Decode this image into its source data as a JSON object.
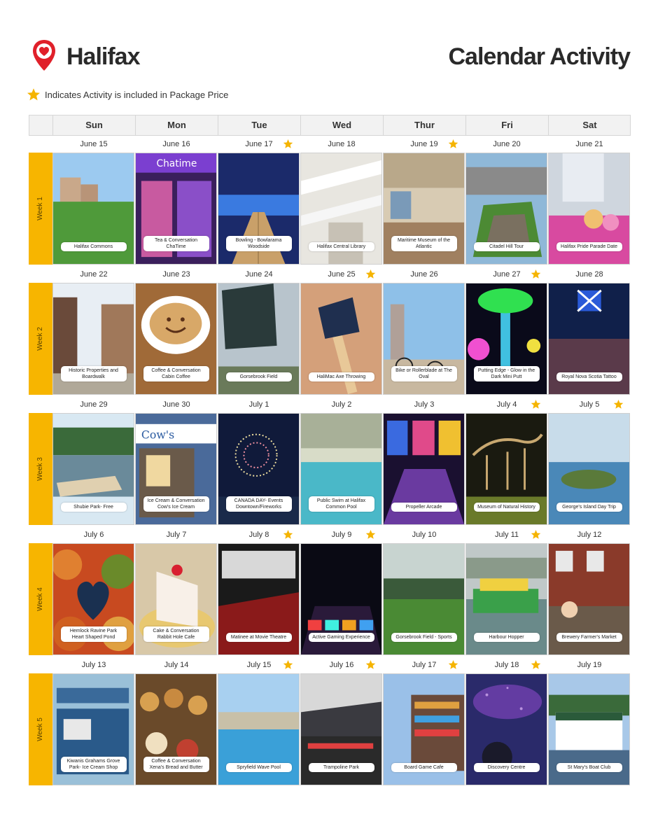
{
  "header": {
    "brand": "Halifax",
    "title": "Calendar Activity",
    "legend_text": "Indicates Activity is included in Package Price"
  },
  "colors": {
    "accent": "#f7b500",
    "pin": "#e0202a",
    "star": "#f5b400"
  },
  "days": [
    "Sun",
    "Mon",
    "Tue",
    "Wed",
    "Thur",
    "Fri",
    "Sat"
  ],
  "weeks": [
    {
      "label": "Week 1",
      "cells": [
        {
          "date": "June 15",
          "star": false,
          "activity": "Halifax Commons",
          "theme": "park"
        },
        {
          "date": "June 16",
          "star": false,
          "activity": "Tea & Conversation ChaTime",
          "theme": "store-purple"
        },
        {
          "date": "June 17",
          "star": true,
          "activity": "Bowling - Bowlarama Woodside",
          "theme": "bowling"
        },
        {
          "date": "June 18",
          "star": false,
          "activity": "Halifax Central Library",
          "theme": "library"
        },
        {
          "date": "June 19",
          "star": true,
          "activity": "Maritime Museum of the Atlantic",
          "theme": "museum"
        },
        {
          "date": "June 20",
          "star": false,
          "activity": "Citadel Hill Tour",
          "theme": "fort"
        },
        {
          "date": "June 21",
          "star": false,
          "activity": "Halifax Pride Parade Date",
          "theme": "parade"
        }
      ]
    },
    {
      "label": "Week  2",
      "cells": [
        {
          "date": "June 22",
          "star": false,
          "activity": "Historic Properties and Boardwalk",
          "theme": "street"
        },
        {
          "date": "June 23",
          "star": false,
          "activity": "Coffee & Conversation Cabin Coffee",
          "theme": "coffee"
        },
        {
          "date": "June 24",
          "star": false,
          "activity": "Gorsebrook Field",
          "theme": "sign"
        },
        {
          "date": "June 25",
          "star": true,
          "activity": "HaliMac Axe Throwing",
          "theme": "axe"
        },
        {
          "date": "June 26",
          "star": false,
          "activity": "Bike or Rollerblade at The Oval",
          "theme": "bike"
        },
        {
          "date": "June 27",
          "star": true,
          "activity": "Putting Edge - Glow in the Dark Mini Putt",
          "theme": "glow"
        },
        {
          "date": "June 28",
          "star": false,
          "activity": "Royal Nova Scotia Tattoo",
          "theme": "tattoo"
        }
      ]
    },
    {
      "label": "Week 3",
      "cells": [
        {
          "date": "June 29",
          "star": false,
          "activity": "Shubie Park- Free",
          "theme": "lake"
        },
        {
          "date": "June 30",
          "star": false,
          "activity": "Ice Cream & Conversation Cow's Ice Cream",
          "theme": "icecream"
        },
        {
          "date": "July 1",
          "star": false,
          "activity": "CANADA DAY- Events Downtown/Fireworks",
          "theme": "fireworks"
        },
        {
          "date": "July 2",
          "star": false,
          "activity": "Public Swim at Halifax Common Pool",
          "theme": "pool-indoor"
        },
        {
          "date": "July 3",
          "star": false,
          "activity": "Propeller Arcade",
          "theme": "arcade"
        },
        {
          "date": "July 4",
          "star": true,
          "activity": "Museum of Natural History",
          "theme": "dino"
        },
        {
          "date": "July 5",
          "star": true,
          "activity": "George's Island Day Trip",
          "theme": "island"
        }
      ]
    },
    {
      "label": "Week  4",
      "cells": [
        {
          "date": "July 6",
          "star": false,
          "activity": "Hemlock Ravine Park Heart Shaped Pond",
          "theme": "autumn"
        },
        {
          "date": "July 7",
          "star": false,
          "activity": "Cake & Conversation Rabbit Hole Cafe",
          "theme": "cake"
        },
        {
          "date": "July 8",
          "star": true,
          "activity": "Matinee at Movie Theatre",
          "theme": "theatre"
        },
        {
          "date": "July 9",
          "star": true,
          "activity": "Active Gaming Experience",
          "theme": "gaming"
        },
        {
          "date": "July 10",
          "star": false,
          "activity": "Gorsebrook Field - Sports",
          "theme": "field"
        },
        {
          "date": "July 11",
          "star": true,
          "activity": "Harbour Hopper",
          "theme": "boat"
        },
        {
          "date": "July 12",
          "star": false,
          "activity": "Brewery Farmer's Market",
          "theme": "market"
        }
      ]
    },
    {
      "label": "Week  5",
      "cells": [
        {
          "date": "July 13",
          "star": false,
          "activity": "Kiwanis Grahams Grove Park- Ice Cream Shop",
          "theme": "kiosk"
        },
        {
          "date": "July 14",
          "star": false,
          "activity": "Coffee & Conversation Xena's Bread and Butter",
          "theme": "pastry"
        },
        {
          "date": "July 15",
          "star": true,
          "activity": "Spryfield Wave Pool",
          "theme": "wavepool"
        },
        {
          "date": "July 16",
          "star": true,
          "activity": "Trampoline Park",
          "theme": "trampoline"
        },
        {
          "date": "July 17",
          "star": true,
          "activity": "Board Game Cafe",
          "theme": "boardgame"
        },
        {
          "date": "July 18",
          "star": true,
          "activity": "Discovery Centre",
          "theme": "space"
        },
        {
          "date": "July 19",
          "star": false,
          "activity": "St Mary's Boat Club",
          "theme": "boatclub"
        }
      ]
    }
  ]
}
